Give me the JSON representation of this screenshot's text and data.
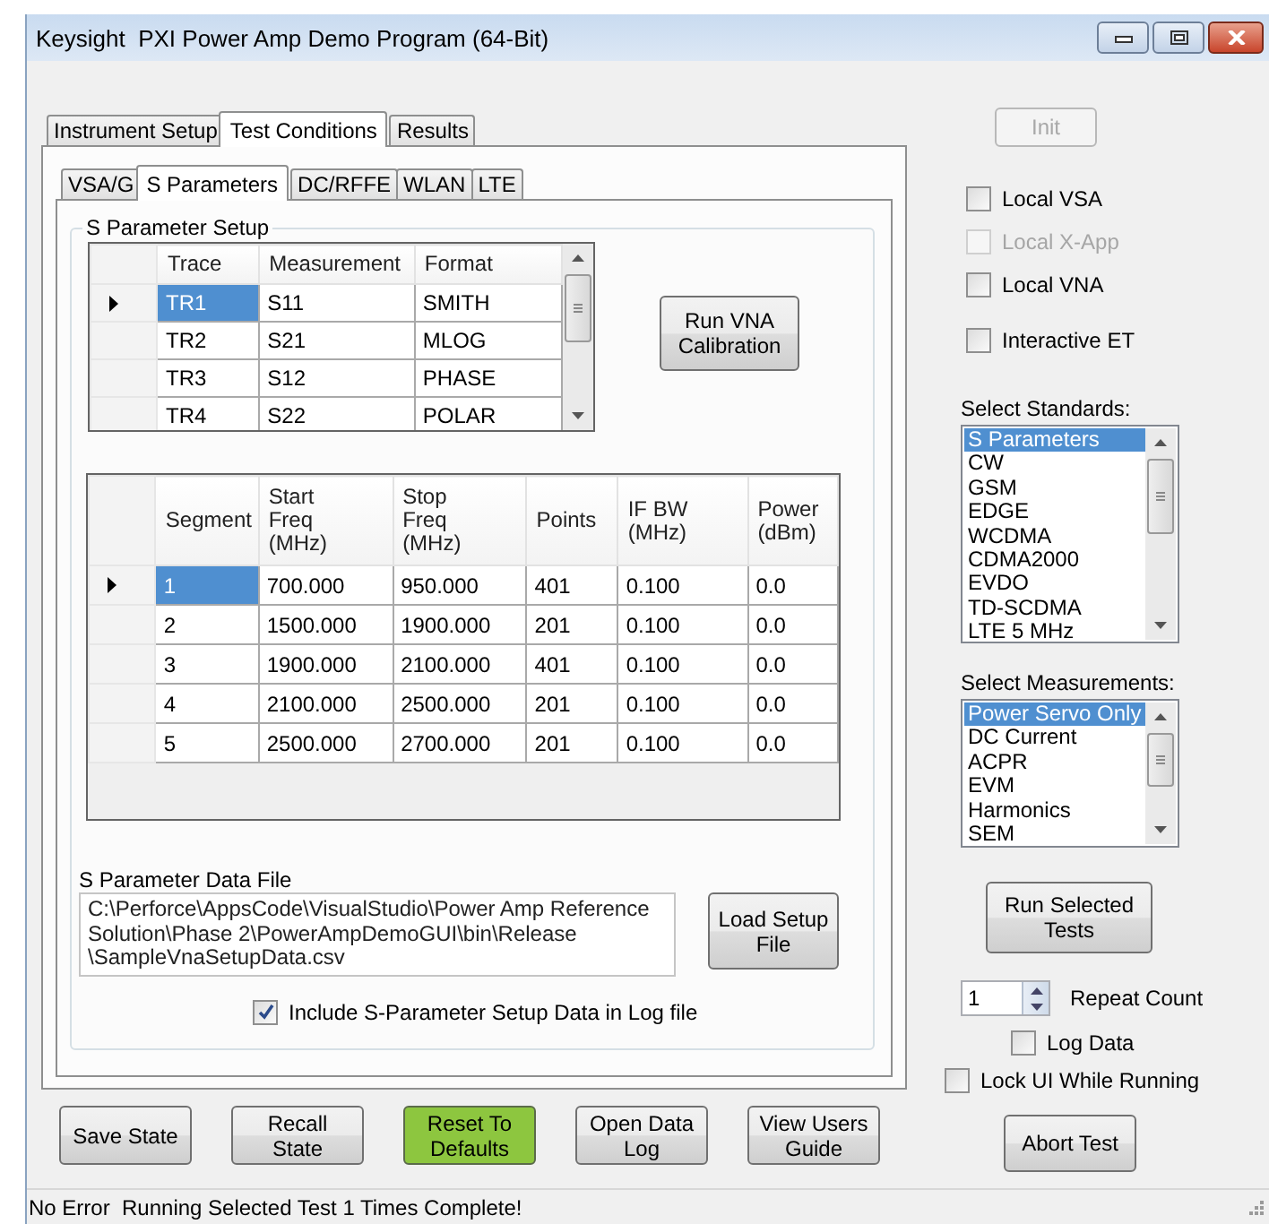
{
  "window": {
    "title": "Keysight  PXI Power Amp Demo Program (64-Bit)"
  },
  "tabs": [
    {
      "label": "Instrument Setup",
      "selected": false
    },
    {
      "label": "Test Conditions",
      "selected": true
    },
    {
      "label": "Results",
      "selected": false
    }
  ],
  "subtabs": [
    {
      "label": "VSA/G",
      "selected": false
    },
    {
      "label": "S Parameters",
      "selected": true
    },
    {
      "label": "DC/RFFE",
      "selected": false
    },
    {
      "label": "WLAN",
      "selected": false
    },
    {
      "label": "LTE",
      "selected": false
    }
  ],
  "s_parameter_setup": {
    "title": "S Parameter Setup",
    "trace_table": {
      "columns": [
        "Trace",
        "Measurement",
        "Format"
      ],
      "rows": [
        {
          "cells": [
            "TR1",
            "S11",
            "SMITH"
          ],
          "selected": true
        },
        {
          "cells": [
            "TR2",
            "S21",
            "MLOG"
          ],
          "selected": false
        },
        {
          "cells": [
            "TR3",
            "S12",
            "PHASE"
          ],
          "selected": false
        },
        {
          "cells": [
            "TR4",
            "S22",
            "POLAR"
          ],
          "selected": false
        }
      ]
    },
    "calibration_button": {
      "label": "Run VNA Calibration"
    },
    "segment_table": {
      "columns": [
        "Segment",
        "Start Freq (MHz)",
        "Stop Freq (MHz)",
        "Points",
        "IF BW (MHz)",
        "Power (dBm)"
      ],
      "rows": [
        {
          "cells": [
            "1",
            "700.000",
            "950.000",
            "401",
            "0.100",
            "0.0"
          ],
          "selected": true
        },
        {
          "cells": [
            "2",
            "1500.000",
            "1900.000",
            "201",
            "0.100",
            "0.0"
          ],
          "selected": false
        },
        {
          "cells": [
            "3",
            "1900.000",
            "2100.000",
            "401",
            "0.100",
            "0.0"
          ],
          "selected": false
        },
        {
          "cells": [
            "4",
            "2100.000",
            "2500.000",
            "201",
            "0.100",
            "0.0"
          ],
          "selected": false
        },
        {
          "cells": [
            "5",
            "2500.000",
            "2700.000",
            "201",
            "0.100",
            "0.0"
          ],
          "selected": false
        }
      ]
    },
    "data_file": {
      "label": "S Parameter Data File",
      "value": "C:\\Perforce\\AppsCode\\VisualStudio\\Power Amp Reference Solution\\Phase 2\\PowerAmpDemoGUI\\bin\\Release \\SampleVnaSetupData.csv"
    },
    "load_button": {
      "label": "Load Setup File"
    },
    "include_in_log": {
      "label": "Include S-Parameter Setup Data in Log file",
      "checked": true
    }
  },
  "bottom_buttons": [
    {
      "label": "Save State",
      "highlighted": false
    },
    {
      "label": "Recall State",
      "highlighted": false
    },
    {
      "label": "Reset To Defaults",
      "highlighted": true
    },
    {
      "label": "Open Data Log",
      "highlighted": false
    },
    {
      "label": "View Users Guide",
      "highlighted": false
    }
  ],
  "side_panel": {
    "init_button": {
      "label": "Init",
      "disabled": true
    },
    "options": [
      {
        "label": "Local VSA",
        "checked": false,
        "disabled": false
      },
      {
        "label": "Local X-App",
        "checked": false,
        "disabled": true
      },
      {
        "label": "Local VNA",
        "checked": false,
        "disabled": false
      },
      {
        "label": "Interactive ET",
        "checked": false,
        "disabled": false
      }
    ],
    "standards": {
      "label": "Select Standards:",
      "items": [
        {
          "label": "S Parameters",
          "selected": true
        },
        {
          "label": "CW",
          "selected": false
        },
        {
          "label": "GSM",
          "selected": false
        },
        {
          "label": "EDGE",
          "selected": false
        },
        {
          "label": "WCDMA",
          "selected": false
        },
        {
          "label": "CDMA2000",
          "selected": false
        },
        {
          "label": "EVDO",
          "selected": false
        },
        {
          "label": "TD-SCDMA",
          "selected": false
        },
        {
          "label": "LTE 5 MHz",
          "selected": false
        }
      ]
    },
    "measurements": {
      "label": "Select Measurements:",
      "items": [
        {
          "label": "Power Servo Only",
          "selected": true
        },
        {
          "label": "DC Current",
          "selected": false
        },
        {
          "label": "ACPR",
          "selected": false
        },
        {
          "label": "EVM",
          "selected": false
        },
        {
          "label": "Harmonics",
          "selected": false
        },
        {
          "label": "SEM",
          "selected": false
        }
      ]
    },
    "run_button": {
      "label": "Run Selected Tests"
    },
    "repeat": {
      "value": "1",
      "label": "Repeat Count"
    },
    "log_data": {
      "label": "Log Data",
      "checked": false
    },
    "lock_ui": {
      "label": "Lock UI While Running",
      "checked": false
    },
    "abort_button": {
      "label": "Abort Test"
    }
  },
  "status_bar": {
    "text": "No Error  Running Selected Test 1 Times Complete!"
  }
}
